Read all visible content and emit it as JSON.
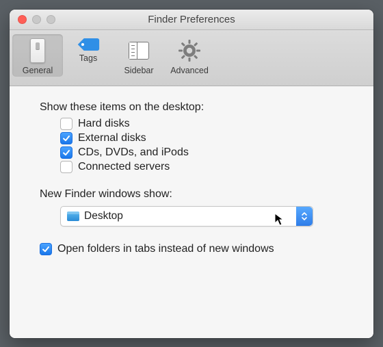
{
  "window": {
    "title": "Finder Preferences"
  },
  "toolbar": {
    "tabs": [
      {
        "label": "General"
      },
      {
        "label": "Tags"
      },
      {
        "label": "Sidebar"
      },
      {
        "label": "Advanced"
      }
    ]
  },
  "desktop_items": {
    "heading": "Show these items on the desktop:",
    "hard_disks": {
      "label": "Hard disks",
      "checked": false
    },
    "external": {
      "label": "External disks",
      "checked": true
    },
    "cds": {
      "label": "CDs, DVDs, and iPods",
      "checked": true
    },
    "servers": {
      "label": "Connected servers",
      "checked": false
    }
  },
  "new_window": {
    "heading": "New Finder windows show:",
    "selected": "Desktop"
  },
  "tabs_option": {
    "label": "Open folders in tabs instead of new windows",
    "checked": true
  }
}
